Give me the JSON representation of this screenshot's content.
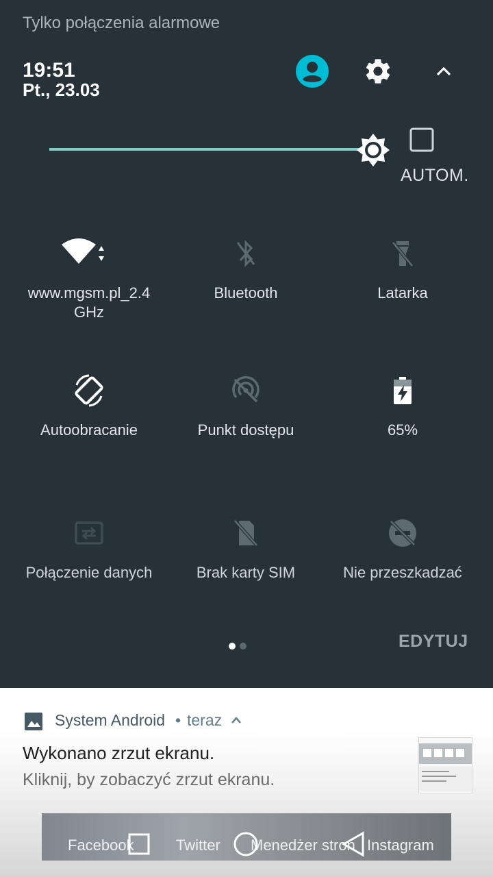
{
  "status": {
    "carrier_text": "Tylko połączenia alarmowe"
  },
  "header": {
    "time": "19:51",
    "date": "Pt., 23.03"
  },
  "brightness": {
    "level": 0.95,
    "auto_label": "AUTOM.",
    "auto_checked": false
  },
  "tiles": [
    {
      "label": "www.mgsm.pl_2.4",
      "label2": "GHz",
      "icon": "wifi-icon",
      "active": true
    },
    {
      "label": "Bluetooth",
      "icon": "bluetooth-off-icon",
      "active": false
    },
    {
      "label": "Latarka",
      "icon": "flashlight-off-icon",
      "active": false
    },
    {
      "label": "Autoobracanie",
      "icon": "auto-rotate-icon",
      "active": true
    },
    {
      "label": "Punkt dostępu",
      "icon": "hotspot-off-icon",
      "active": false
    },
    {
      "label": "65%",
      "icon": "battery-charging-icon",
      "active": true
    },
    {
      "label": "Połączenie danych",
      "icon": "mobile-data-icon",
      "active": false
    },
    {
      "label": "Brak karty SIM",
      "icon": "no-sim-icon",
      "active": false
    },
    {
      "label": "Nie przeszkadzać",
      "icon": "do-not-disturb-icon",
      "active": false
    }
  ],
  "pager": {
    "pages": 2,
    "current": 1
  },
  "edit_label": "EDYTUJ",
  "notification": {
    "app": "System Android",
    "time": "teraz",
    "title": "Wykonano zrzut ekranu.",
    "text": "Kliknij, by zobaczyć zrzut ekranu."
  },
  "preview": {
    "labels": [
      "Facebook",
      "Twitter",
      "Menedżer stron",
      "Instagram"
    ]
  },
  "colors": {
    "panel_bg": "#263238",
    "accent": "#00bcd4",
    "slider": "#80cbc4"
  }
}
